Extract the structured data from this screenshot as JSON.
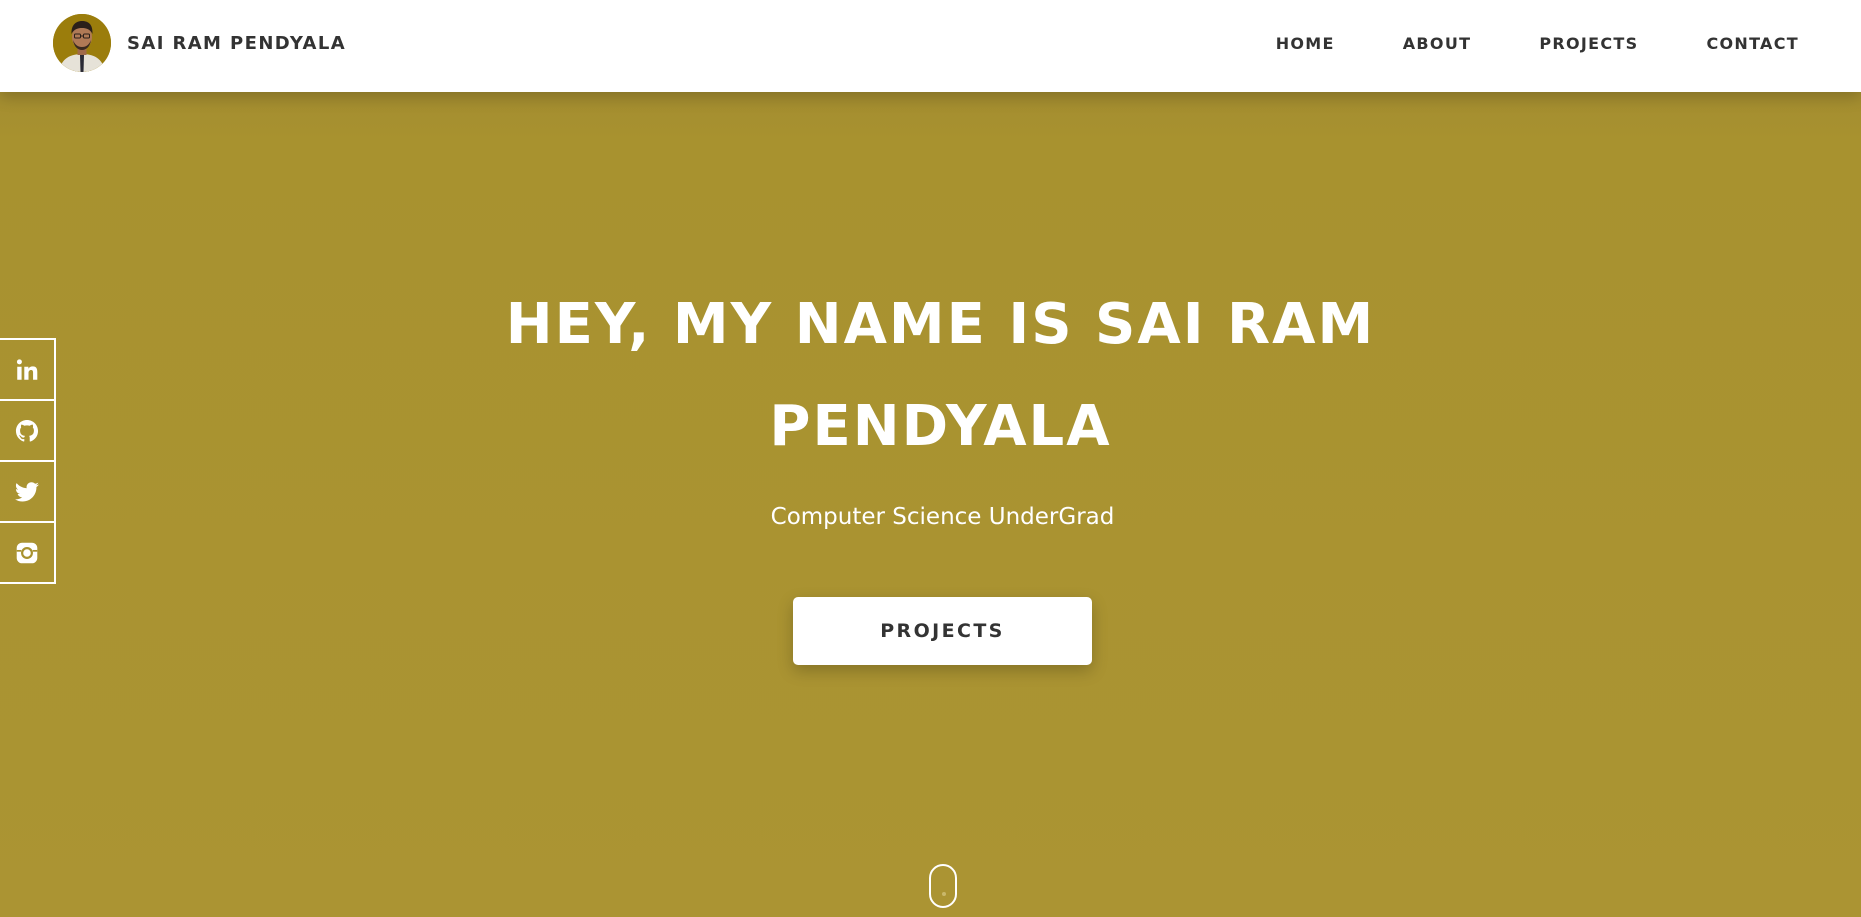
{
  "header": {
    "brand_name": "SAI RAM PENDYALA",
    "nav": [
      {
        "label": "HOME"
      },
      {
        "label": "ABOUT"
      },
      {
        "label": "PROJECTS"
      },
      {
        "label": "CONTACT"
      }
    ]
  },
  "hero": {
    "title": "HEY, MY NAME IS SAI RAM PENDYALA",
    "subtitle": "Computer Science UnderGrad",
    "cta_label": "PROJECTS"
  },
  "social": [
    {
      "icon": "linkedin-icon"
    },
    {
      "icon": "github-icon"
    },
    {
      "icon": "twitter-icon"
    },
    {
      "icon": "instagram-icon"
    }
  ],
  "colors": {
    "hero_background": "#a8922f",
    "header_background": "#ffffff",
    "text_dark": "#333333",
    "text_light": "#ffffff"
  }
}
